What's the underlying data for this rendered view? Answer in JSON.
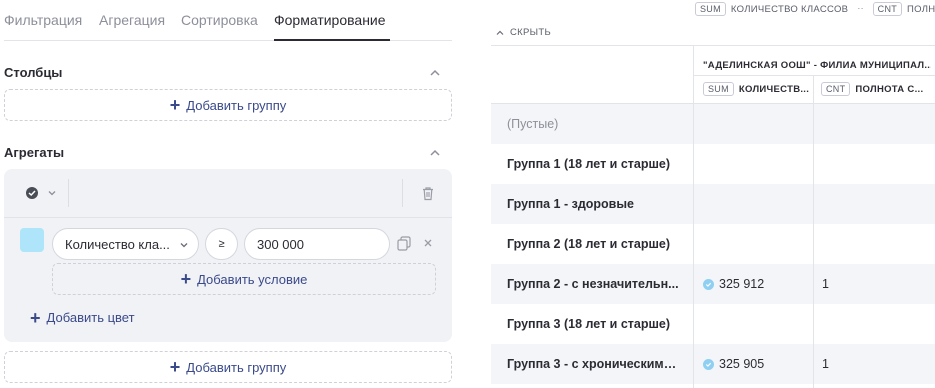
{
  "tabs": [
    {
      "label": "Фильтрация"
    },
    {
      "label": "Агрегация"
    },
    {
      "label": "Сортировка"
    },
    {
      "label": "Форматирование"
    }
  ],
  "columns_section": {
    "title": "Столбцы",
    "add_group_label": "Добавить группу"
  },
  "aggregates_section": {
    "title": "Агрегаты",
    "rule": {
      "swatch_color": "#aee5fb",
      "field_value": "Количество кла...",
      "operator": "≥",
      "threshold": "300 000",
      "add_condition_label": "Добавить условие",
      "add_color_label": "Добавить цвет"
    },
    "add_group_label": "Добавить группу"
  },
  "grid": {
    "top_chips": [
      {
        "chip": "SUM",
        "label": "КОЛИЧЕСТВО КЛАССОВ"
      },
      {
        "chip": "CNT",
        "label": "ПОЛНО"
      }
    ],
    "hide_label": "СКРЫТЬ",
    "column_group_header": "\"АДЕЛИНСКАЯ ООШ\" - ФИЛИА МУНИЦИПАЛ...",
    "columns": [
      {
        "chip": "SUM",
        "label": "КОЛИЧЕСТВ..."
      },
      {
        "chip": "CNT",
        "label": "ПОЛНОТА С..."
      }
    ],
    "rows": [
      {
        "label": "(Пустые)",
        "sum": "",
        "cnt": "",
        "muted": true
      },
      {
        "label": "Группа 1 (18 лет и старше)",
        "sum": "",
        "cnt": ""
      },
      {
        "label": "Группа 1 - здоровые",
        "sum": "",
        "cnt": ""
      },
      {
        "label": "Группа 2 (18 лет и старше)",
        "sum": "",
        "cnt": ""
      },
      {
        "label": "Группа 2 - с незначительн...",
        "sum": "325 912",
        "cnt": "1",
        "highlight": true
      },
      {
        "label": "Группа 3 (18 лет и старше)",
        "sum": "",
        "cnt": ""
      },
      {
        "label": "Группа 3 - с хроническими ...",
        "sum": "325 905",
        "cnt": "1",
        "highlight": true
      }
    ]
  },
  "colors": {
    "accent": "#3a4a8a",
    "row_alt": "#f4f5f8",
    "panel": "#f1f2f6",
    "swatch": "#aee5fb"
  }
}
